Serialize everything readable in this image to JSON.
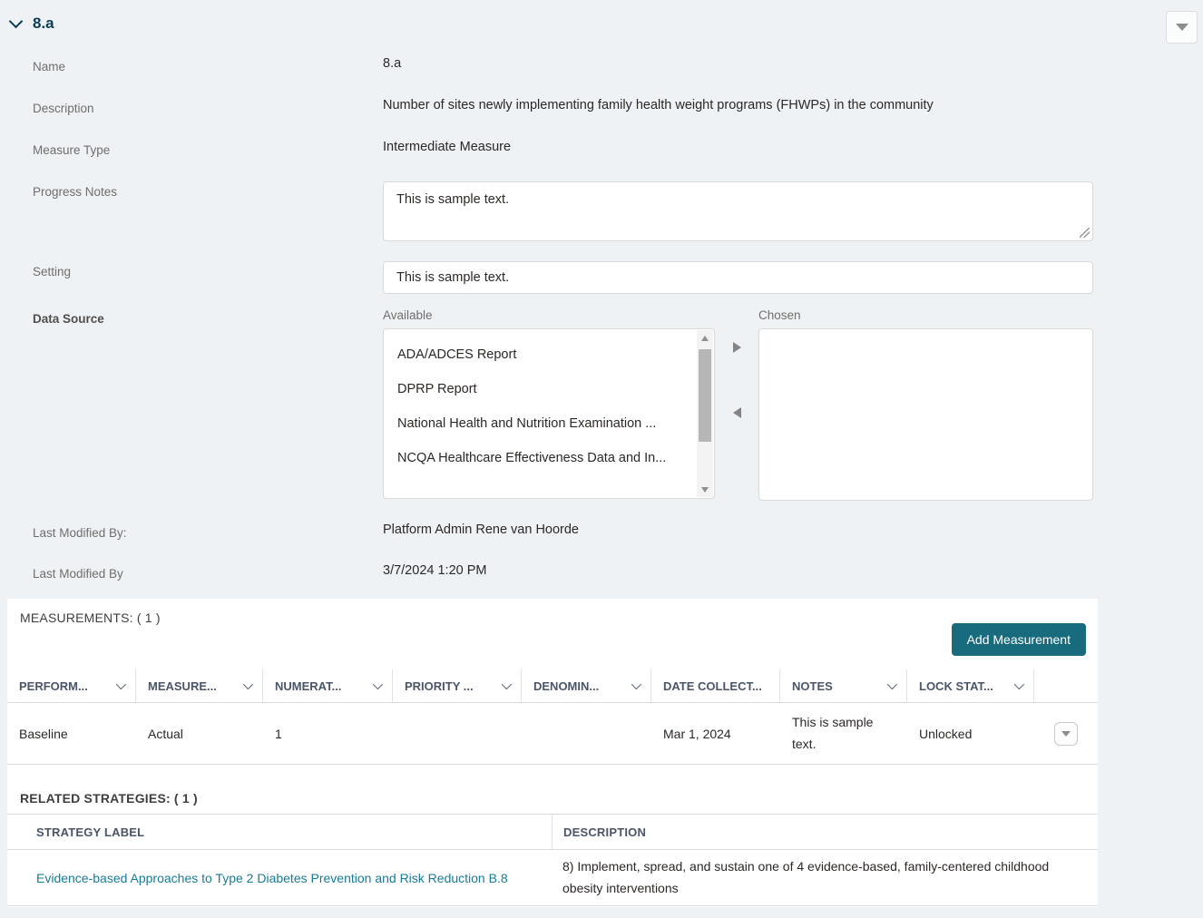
{
  "colors": {
    "background": "#eef2f5",
    "title_navy": "#0d3c55",
    "accent_teal": "#176b7c",
    "link_teal": "#177b9b",
    "label_gray": "#706e6b",
    "border_gray": "#dddbda",
    "text_dark": "#2b2826"
  },
  "icons": {
    "section_collapse": "chevron-down",
    "top_menu": "triangle-down",
    "move_right": "triangle-right",
    "move_left": "triangle-left",
    "scroll_up": "triangle-up",
    "scroll_down": "triangle-down",
    "column_sort": "chevron-down",
    "row_menu": "triangle-down",
    "textarea_resize": "resize-grip"
  },
  "section": {
    "title": "8.a"
  },
  "form": {
    "name_label": "Name",
    "name_value": "8.a",
    "description_label": "Description",
    "description_value": "Number of sites newly implementing family health weight programs (FHWPs) in the community",
    "measure_type_label": "Measure Type",
    "measure_type_value": "Intermediate Measure",
    "progress_notes_label": "Progress Notes",
    "progress_notes_value": "This is sample text.",
    "setting_label": "Setting",
    "setting_value": "This is sample text.",
    "data_source_label": "Data Source",
    "available_label": "Available",
    "available_options": [
      "ADA/ADCES Report",
      "DPRP Report",
      "National Health and Nutrition Examination ...",
      "NCQA Healthcare Effectiveness Data and In..."
    ],
    "chosen_label": "Chosen",
    "chosen_options": [],
    "last_modified_by_label": "Last Modified By:",
    "last_modified_by_value": "Platform Admin Rene van Hoorde",
    "last_modified_date_label": "Last Modified By",
    "last_modified_date_value": "3/7/2024 1:20 PM"
  },
  "measurements": {
    "title": "MEASUREMENTS: ( 1 )",
    "add_button_label": "Add Measurement",
    "columns": [
      {
        "label": "PERFORM...",
        "sortable": true
      },
      {
        "label": "MEASURE...",
        "sortable": true
      },
      {
        "label": "NUMERAT...",
        "sortable": true
      },
      {
        "label": "PRIORITY ...",
        "sortable": true
      },
      {
        "label": "DENOMIN...",
        "sortable": true
      },
      {
        "label": "DATE COLLECT...",
        "sortable": false
      },
      {
        "label": "NOTES",
        "sortable": true
      },
      {
        "label": "LOCK STAT...",
        "sortable": true
      },
      {
        "label": "",
        "sortable": false
      }
    ],
    "rows": [
      {
        "performance": "Baseline",
        "measure": "Actual",
        "numerator": "1",
        "priority": "",
        "denominator": "",
        "date_collected": "Mar 1, 2024",
        "notes": "This is sample text.",
        "lock_status": "Unlocked"
      }
    ]
  },
  "related_strategies": {
    "title": "RELATED STRATEGIES: ( 1 )",
    "columns": {
      "label": "STRATEGY LABEL",
      "description": "DESCRIPTION"
    },
    "rows": [
      {
        "label": "Evidence-based Approaches to Type 2 Diabetes Prevention and Risk Reduction B.8",
        "description": "8) Implement, spread, and sustain one of 4 evidence-based, family-centered childhood obesity interventions"
      }
    ]
  }
}
